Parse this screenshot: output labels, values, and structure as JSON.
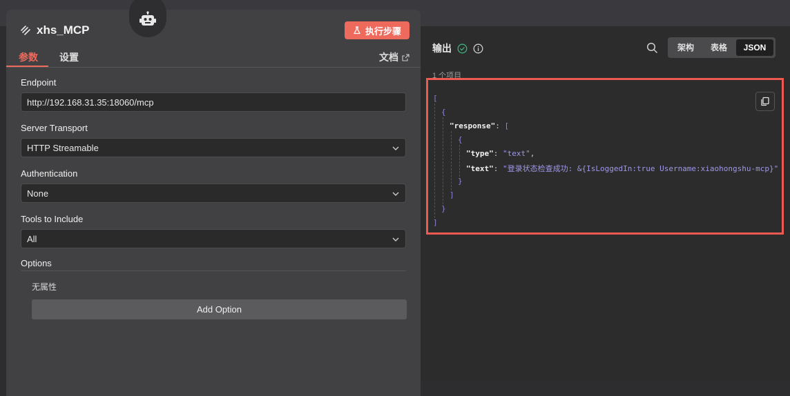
{
  "node": {
    "title": "xhs_MCP",
    "execute_label": "执行步骤",
    "tabs": [
      {
        "label": "参数"
      },
      {
        "label": "设置"
      }
    ],
    "docs_label": "文档"
  },
  "form": {
    "endpoint": {
      "label": "Endpoint",
      "value": "http://192.168.31.35:18060/mcp"
    },
    "server_transport": {
      "label": "Server Transport",
      "value": "HTTP Streamable"
    },
    "authentication": {
      "label": "Authentication",
      "value": "None"
    },
    "tools": {
      "label": "Tools to Include",
      "value": "All"
    },
    "options": {
      "label": "Options",
      "empty_text": "无属性",
      "add_label": "Add Option"
    }
  },
  "output": {
    "title": "输出",
    "search_icon": "search-icon",
    "views": [
      {
        "label": "架构"
      },
      {
        "label": "表格"
      },
      {
        "label": "JSON"
      }
    ],
    "active_view": "JSON",
    "items_count": "1 个项目",
    "json": {
      "open_outer": "[",
      "open_obj": "{",
      "response_key": "\"response\"",
      "colon1": ": ",
      "open_arr": "[",
      "open_inner": "{",
      "type_key": "\"type\"",
      "type_colon": ": ",
      "type_val": "\"text\"",
      "type_comma": ",",
      "text_key": "\"text\"",
      "text_colon": ": ",
      "text_val": "\"登录状态检查成功: &{IsLoggedIn:true Username:xiaohongshu-mcp}\"",
      "close_inner": "}",
      "close_arr": "]",
      "close_obj": "}",
      "close_outer": "]"
    }
  },
  "colors": {
    "accent": "#ee6a5d",
    "success": "#3fb27f",
    "json_string": "#9d98e6",
    "highlight_border": "#ee5a52"
  }
}
